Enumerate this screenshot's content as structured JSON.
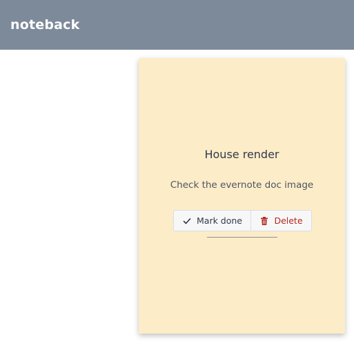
{
  "app": {
    "title": "noteback"
  },
  "note": {
    "title": "House render",
    "body": "Check the evernote doc image",
    "actions": {
      "mark_done": {
        "label": "Mark done",
        "icon": "check-icon"
      },
      "delete": {
        "label": "Delete",
        "icon": "trash-icon"
      }
    }
  },
  "colors": {
    "header": "#7d8a99",
    "card": "#fdecc8",
    "delete": "#b3261e"
  }
}
